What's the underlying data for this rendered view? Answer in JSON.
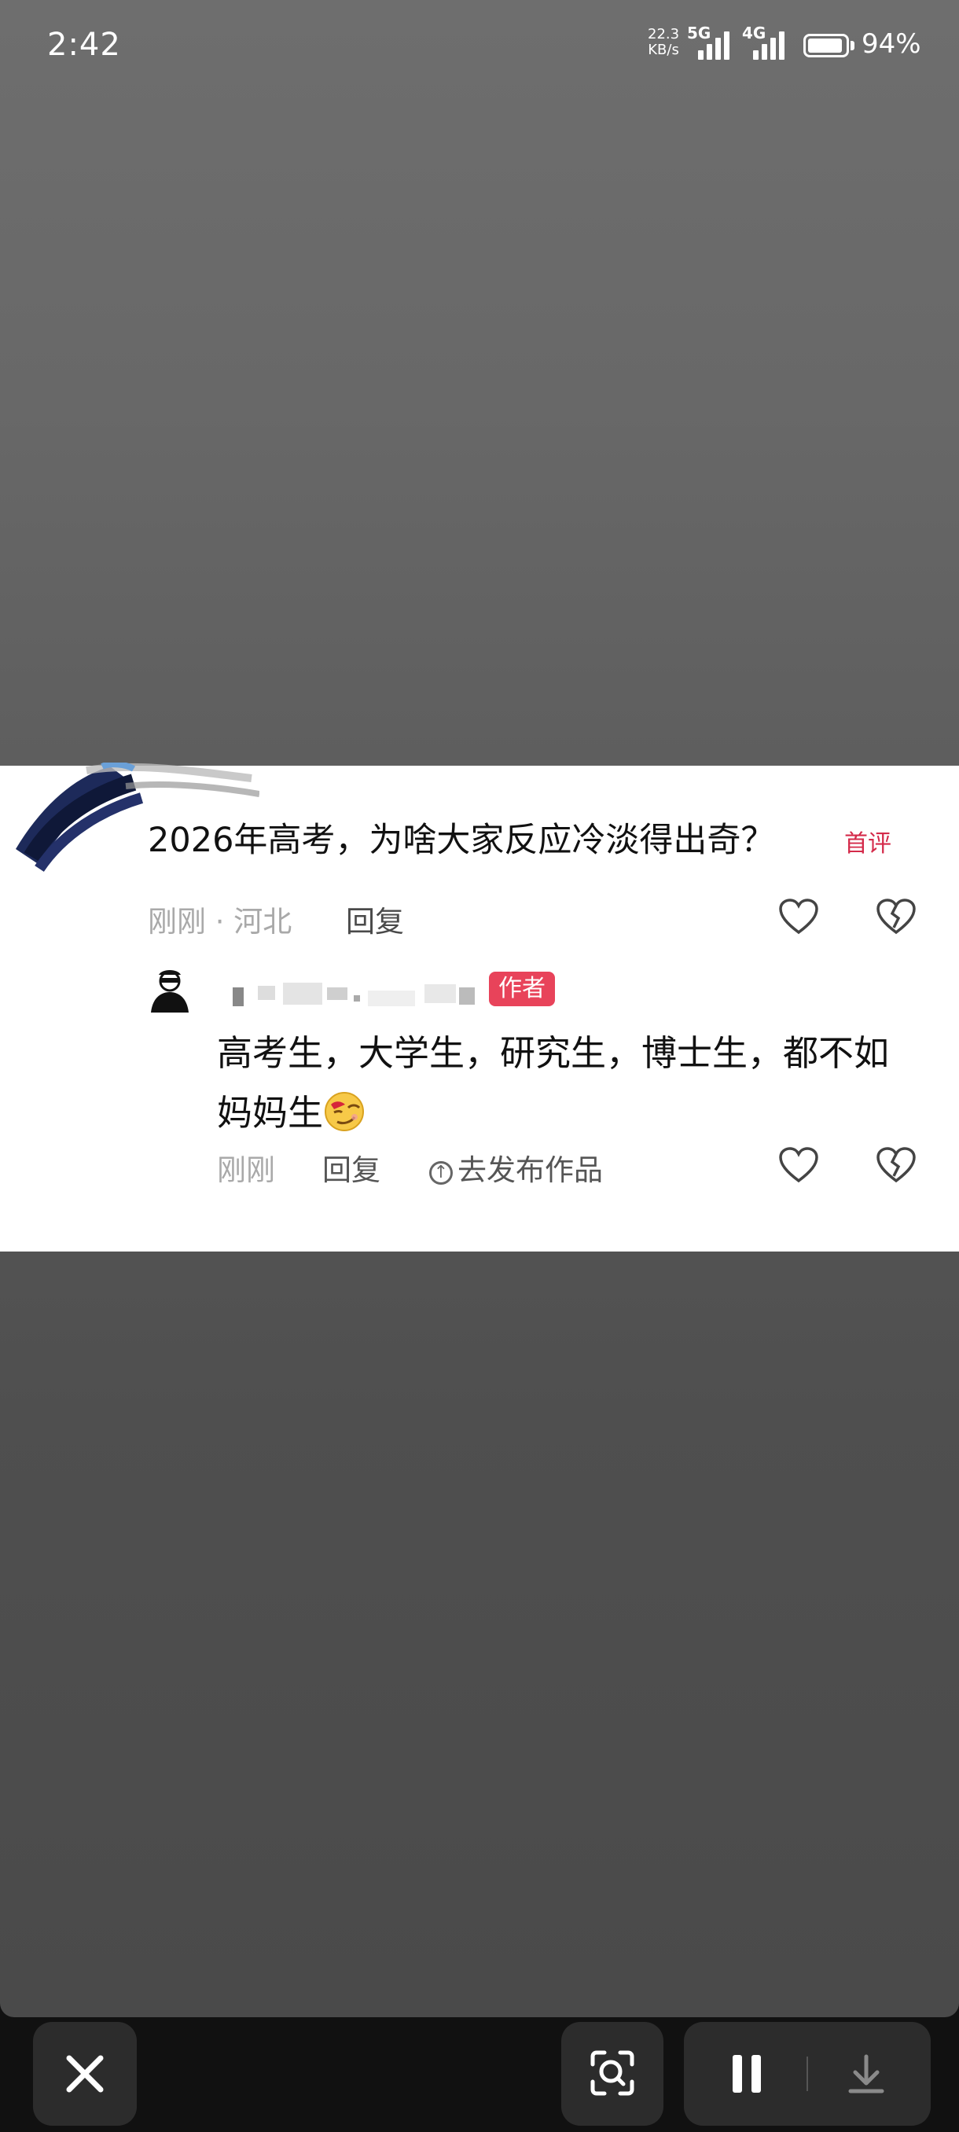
{
  "status_bar": {
    "time": "2:42",
    "speed_value": "22.3",
    "speed_unit": "KB/s",
    "network_primary": "5G",
    "network_secondary": "4G",
    "battery_percent": "94%",
    "battery_level": 0.94
  },
  "comment": {
    "text": "2026年高考，为啥大家反应冷淡得出奇？",
    "badge": "首评",
    "meta": "刚刚 · 河北",
    "reply_label": "回复",
    "icons": [
      "heart-icon",
      "broken-heart-icon"
    ]
  },
  "reply": {
    "author_badge": "作者",
    "text": "高考生，大学生，研究生，博士生，都不如妈妈生",
    "emoji": "smirk-emoji",
    "meta": "刚刚",
    "reply_label": "回复",
    "publish_label": "去发布作品",
    "icons": [
      "heart-icon",
      "broken-heart-icon"
    ]
  },
  "bottom_bar": {
    "buttons": [
      "close-icon",
      "scan-search-icon",
      "pause-icon",
      "download-icon"
    ]
  },
  "colors": {
    "accent_red": "#e8435a",
    "badge_red": "#d42a4a",
    "background_gray": "#5e5e5e"
  }
}
